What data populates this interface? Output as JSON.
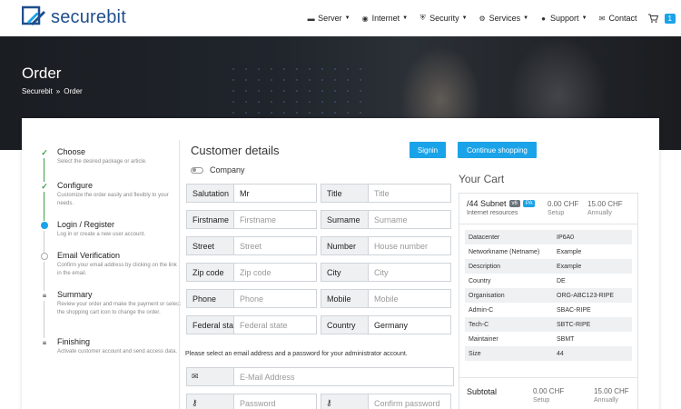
{
  "brand": {
    "name": "securebit",
    "color": "#1f4e8c"
  },
  "nav": [
    {
      "label": "Server",
      "icon": "server-icon",
      "caret": true
    },
    {
      "label": "Internet",
      "icon": "globe-icon",
      "caret": true
    },
    {
      "label": "Security",
      "icon": "shield-icon",
      "caret": true
    },
    {
      "label": "Services",
      "icon": "cogs-icon",
      "caret": true
    },
    {
      "label": "Support",
      "icon": "chat-icon",
      "caret": true
    },
    {
      "label": "Contact",
      "icon": "envelope-icon",
      "caret": false
    }
  ],
  "cart_count": "1",
  "hero": {
    "title": "Order",
    "breadcrumb": [
      "Securebit",
      "Order"
    ]
  },
  "steps": [
    {
      "title": "Choose",
      "desc": "Select the desired package or article.",
      "state": "done"
    },
    {
      "title": "Configure",
      "desc": "Customize the order easily and flexibly to your needs.",
      "state": "done"
    },
    {
      "title": "Login / Register",
      "desc": "Log in or create a new user account.",
      "state": "active"
    },
    {
      "title": "Email Verification",
      "desc": "Confirm your email address by clicking on the link in the email.",
      "state": "pending"
    },
    {
      "title": "Summary",
      "desc": "Review your order and make the payment or select the shopping cart icon to change the order.",
      "state": "locked"
    },
    {
      "title": "Finishing",
      "desc": "Activate customer account and send access data.",
      "state": "locked"
    }
  ],
  "customer": {
    "title": "Customer details",
    "signin_label": "Signin",
    "continue_label": "Continue shopping",
    "company_label": "Company",
    "fields": {
      "salutation": {
        "label": "Salutation",
        "value": "Mr",
        "placeholder": ""
      },
      "title": {
        "label": "Title",
        "value": "",
        "placeholder": "Title"
      },
      "firstname": {
        "label": "Firstname",
        "value": "",
        "placeholder": "Firstname"
      },
      "surname": {
        "label": "Surname",
        "value": "",
        "placeholder": "Surname"
      },
      "street": {
        "label": "Street",
        "value": "",
        "placeholder": "Street"
      },
      "number": {
        "label": "Number",
        "value": "",
        "placeholder": "House number"
      },
      "zip": {
        "label": "Zip code",
        "value": "",
        "placeholder": "Zip code"
      },
      "city": {
        "label": "City",
        "value": "",
        "placeholder": "City"
      },
      "phone": {
        "label": "Phone",
        "value": "",
        "placeholder": "Phone"
      },
      "mobile": {
        "label": "Mobile",
        "value": "",
        "placeholder": "Mobile"
      },
      "state": {
        "label": "Federal state",
        "value": "",
        "placeholder": "Federal state"
      },
      "country": {
        "label": "Country",
        "value": "Germany",
        "placeholder": ""
      }
    },
    "account_note": "Please select an email address and a password for your administrator account.",
    "email_placeholder": "E-Mail Address",
    "password_placeholder": "Password",
    "confirm_placeholder": "Confirm password"
  },
  "cart": {
    "title": "Your Cart",
    "item": {
      "name": "/44 Subnet",
      "tags": [
        "v6",
        "PA"
      ],
      "category": "Internet resources",
      "setup_price": "0.00 CHF",
      "setup_label": "Setup",
      "annual_price": "15.00 CHF",
      "annual_label": "Annually"
    },
    "details": [
      {
        "k": "Datacenter",
        "v": "IP6A0"
      },
      {
        "k": "Networkname (Netname)",
        "v": "Example"
      },
      {
        "k": "Description",
        "v": "Example"
      },
      {
        "k": "Country",
        "v": "DE"
      },
      {
        "k": "Organisation",
        "v": "ORG-ABC123-RIPE"
      },
      {
        "k": "Admin-C",
        "v": "SBAC-RIPE"
      },
      {
        "k": "Tech-C",
        "v": "SBTC-RIPE"
      },
      {
        "k": "Maintainer",
        "v": "SBMT"
      },
      {
        "k": "Size",
        "v": "44"
      }
    ],
    "subtotal": {
      "label": "Subtotal",
      "setup_price": "0.00 CHF",
      "setup_label": "Setup",
      "annual_price": "15.00 CHF",
      "annual_label": "Annually"
    }
  },
  "colors": {
    "accent": "#1aa3e8",
    "done": "#3aa14a"
  }
}
